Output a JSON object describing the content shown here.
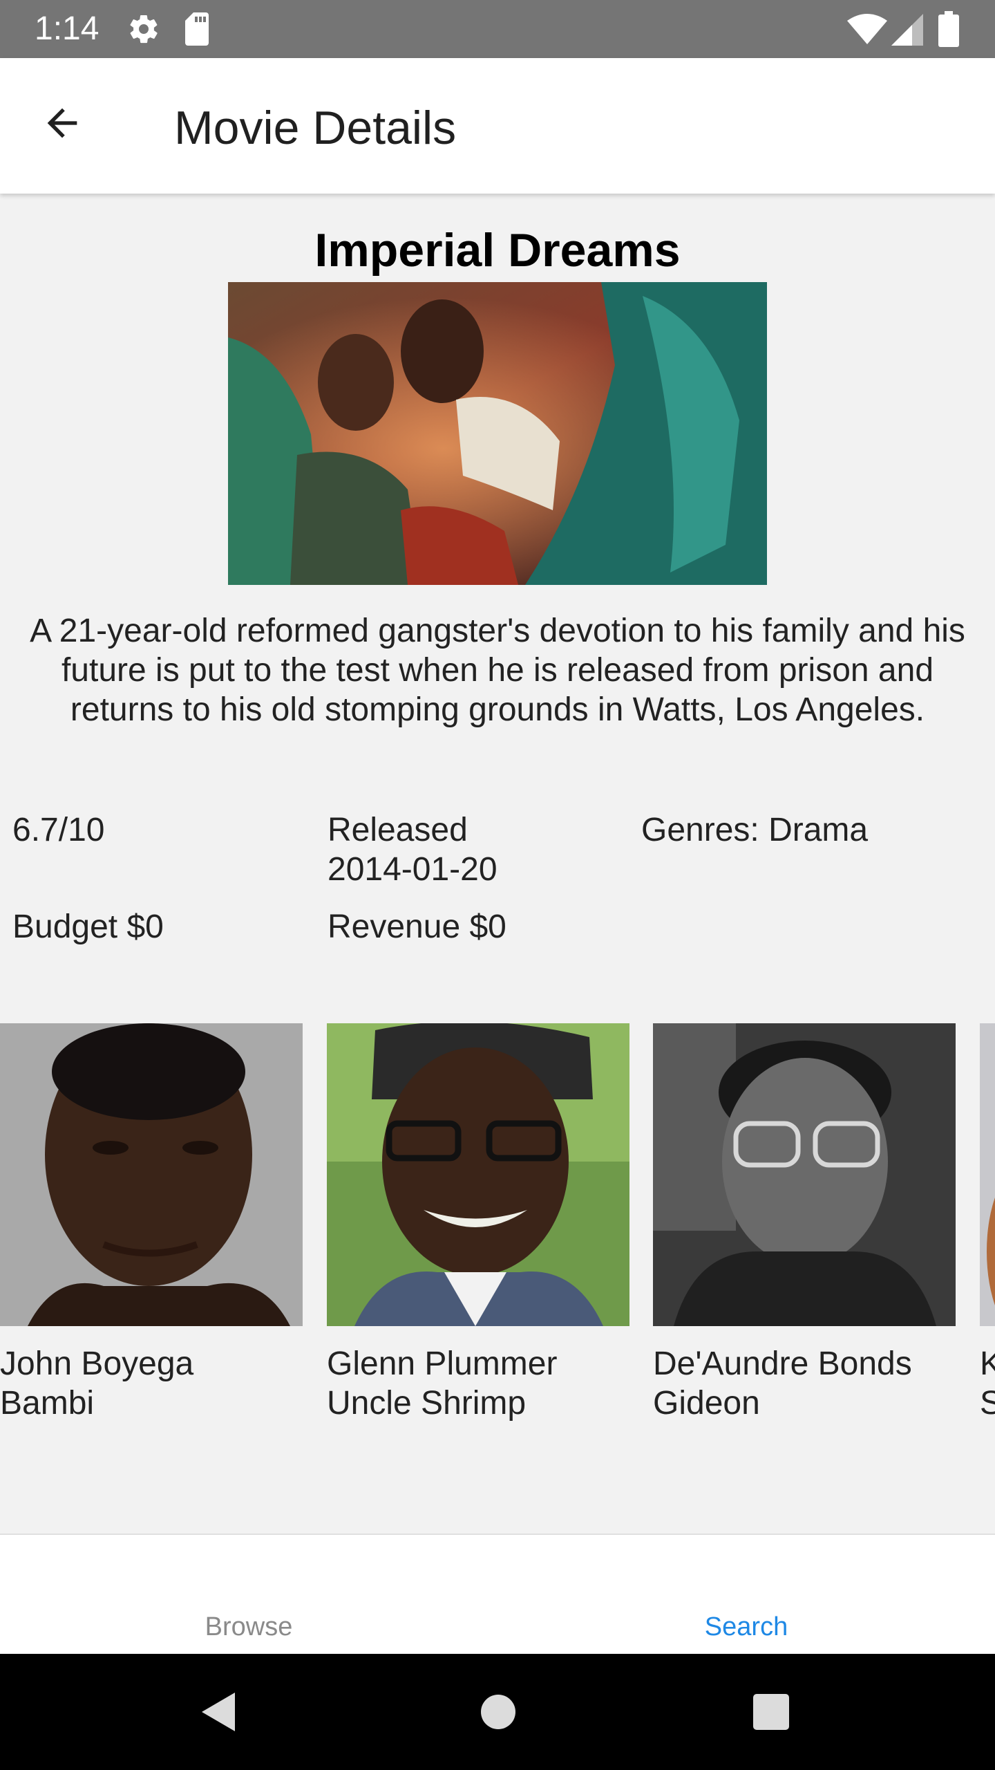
{
  "status_bar": {
    "time": "1:14",
    "icons": [
      "gear-icon",
      "sd-card-icon",
      "wifi-icon",
      "signal-icon",
      "battery-icon"
    ]
  },
  "app_bar": {
    "title": "Movie Details",
    "back_icon": "arrow-left-icon"
  },
  "movie": {
    "title": "Imperial Dreams",
    "overview": "A 21-year-old reformed gangster's devotion to his family and his future is put to the test when he is released from prison and returns to his old stomping grounds in Watts, Los Angeles.",
    "rating": "6.7/10",
    "released_label": "Released",
    "released_date": "2014-01-20",
    "genres": "Genres: Drama",
    "budget": "Budget $0",
    "revenue": "Revenue $0"
  },
  "cast": [
    {
      "name": "John Boyega",
      "role": "Bambi"
    },
    {
      "name": "Glenn Plummer",
      "role": "Uncle Shrimp"
    },
    {
      "name": "De'Aundre Bonds",
      "role": "Gideon"
    },
    {
      "name": "K",
      "role": "S"
    }
  ],
  "bottom_nav": {
    "items": [
      {
        "label": "Browse",
        "active": false
      },
      {
        "label": "Search",
        "active": true
      }
    ],
    "active_color": "#1e88e5",
    "inactive_color": "#8a8a8a"
  },
  "system_nav": {
    "icons": [
      "back-triangle-icon",
      "home-circle-icon",
      "recents-square-icon"
    ]
  }
}
